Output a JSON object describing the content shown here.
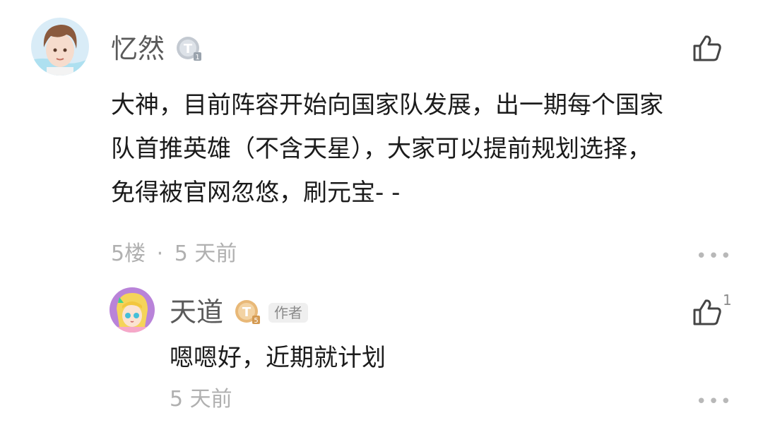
{
  "comment": {
    "username": "忆然",
    "level_badge": "T1",
    "text_lines": [
      "大神，目前阵容开始向国家队发展，出一期每个国家",
      "队首推英雄（不含天星），大家可以提前规划选择，",
      "免得被官网忽悠，刷元宝- -"
    ],
    "floor": "5楼",
    "separator": "·",
    "time": "5 天前",
    "more_label": "•••",
    "like_icon": "thumbs-up-icon"
  },
  "reply": {
    "username": "天道",
    "level_badge": "T5",
    "author_tag": "作者",
    "text": "嗯嗯好，近期就计划",
    "time": "5 天前",
    "like_count": "1",
    "more_label": "•••",
    "like_icon": "thumbs-up-icon"
  },
  "colors": {
    "name": "#5a5a5a",
    "meta": "#b0b0b0",
    "badge_silver": "#c3c9d1",
    "badge_gold": "#e8b877"
  }
}
